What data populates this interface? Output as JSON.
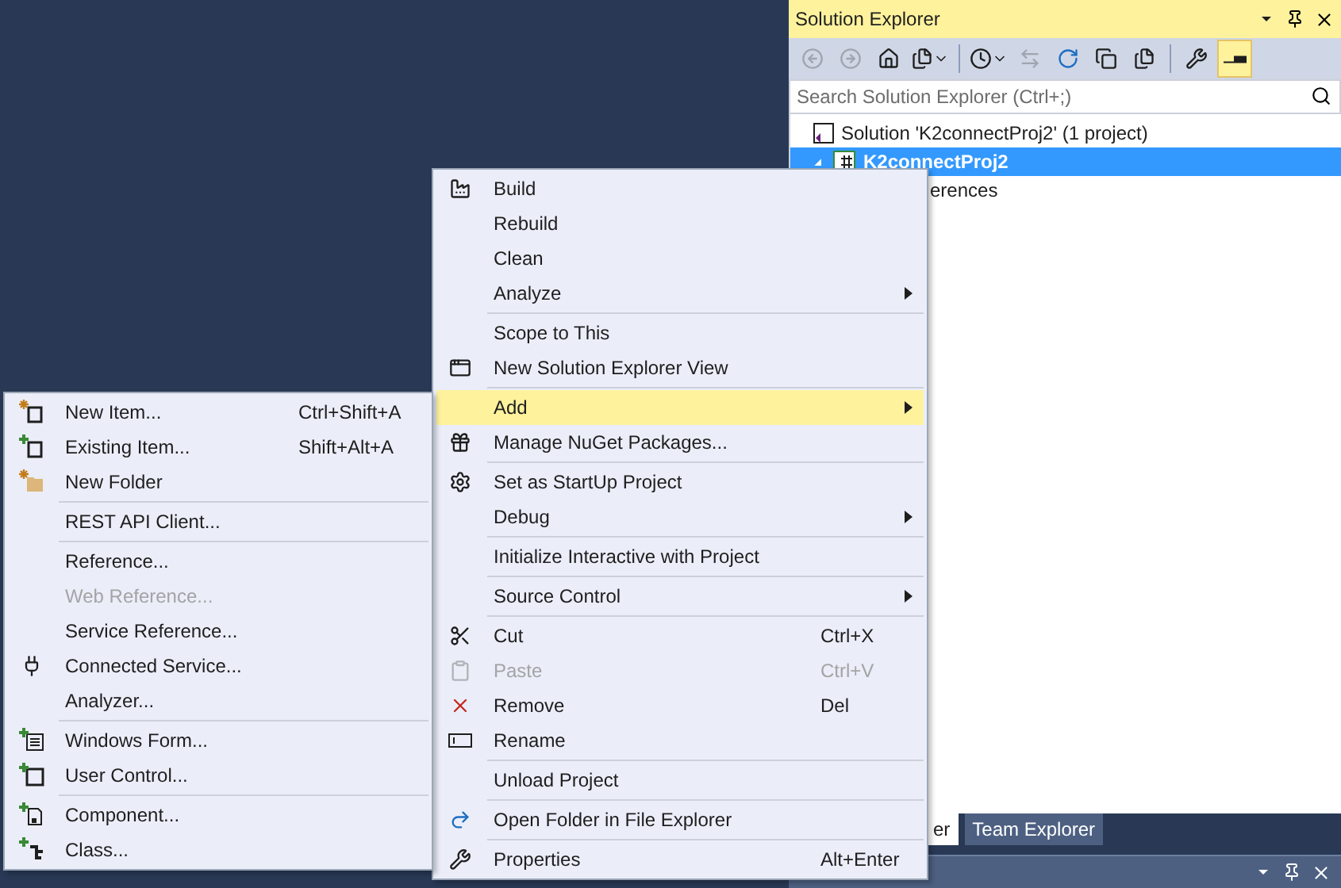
{
  "solution_explorer": {
    "title": "Solution Explorer",
    "toolbar_buttons": [
      {
        "disabled": true,
        "pressed": false
      },
      {
        "disabled": true,
        "pressed": false
      },
      {
        "disabled": false,
        "pressed": false
      },
      {
        "disabled": false,
        "pressed": false
      },
      {
        "disabled": false,
        "pressed": false
      },
      {
        "disabled": true,
        "pressed": false
      },
      {
        "disabled": false,
        "pressed": false
      },
      {
        "disabled": false,
        "pressed": false
      },
      {
        "disabled": false,
        "pressed": false
      },
      {
        "disabled": false,
        "pressed": false
      },
      {
        "disabled": false,
        "pressed": true
      }
    ],
    "search": {
      "placeholder": "Search Solution Explorer (Ctrl+;)"
    },
    "tree": [
      {
        "label": "Solution 'K2connectProj2' (1 project)",
        "selected": false,
        "children": [
          {
            "label": "K2connectProj2",
            "selected": true,
            "children": [
              {
                "label": "erences",
                "selected": false
              }
            ]
          }
        ]
      }
    ],
    "tabs": [
      {
        "label": "er",
        "selected": true
      },
      {
        "label": "Team Explorer",
        "selected": false
      }
    ]
  },
  "context_menu": {
    "items": [
      {
        "kind": "item",
        "label": "Build",
        "submenu": false,
        "disabled": false,
        "selected": false
      },
      {
        "kind": "item",
        "label": "Rebuild",
        "submenu": false,
        "disabled": false,
        "selected": false
      },
      {
        "kind": "item",
        "label": "Clean",
        "submenu": false,
        "disabled": false,
        "selected": false
      },
      {
        "kind": "item",
        "label": "Analyze",
        "submenu": true,
        "disabled": false,
        "selected": false
      },
      {
        "kind": "separator"
      },
      {
        "kind": "item",
        "label": "Scope to This",
        "submenu": false,
        "disabled": false,
        "selected": false
      },
      {
        "kind": "item",
        "label": "New Solution Explorer View",
        "submenu": false,
        "disabled": false,
        "selected": false
      },
      {
        "kind": "separator"
      },
      {
        "kind": "item",
        "label": "Add",
        "submenu": true,
        "disabled": false,
        "selected": true
      },
      {
        "kind": "item",
        "label": "Manage NuGet Packages...",
        "submenu": false,
        "disabled": false,
        "selected": false
      },
      {
        "kind": "separator"
      },
      {
        "kind": "item",
        "label": "Set as StartUp Project",
        "submenu": false,
        "disabled": false,
        "selected": false
      },
      {
        "kind": "item",
        "label": "Debug",
        "submenu": true,
        "disabled": false,
        "selected": false
      },
      {
        "kind": "separator"
      },
      {
        "kind": "item",
        "label": "Initialize Interactive with Project",
        "submenu": false,
        "disabled": false,
        "selected": false
      },
      {
        "kind": "separator"
      },
      {
        "kind": "item",
        "label": "Source Control",
        "submenu": true,
        "disabled": false,
        "selected": false
      },
      {
        "kind": "separator"
      },
      {
        "kind": "item",
        "label": "Cut",
        "shortcut": "Ctrl+X",
        "submenu": false,
        "disabled": false,
        "selected": false
      },
      {
        "kind": "item",
        "label": "Paste",
        "shortcut": "Ctrl+V",
        "submenu": false,
        "disabled": true,
        "selected": false
      },
      {
        "kind": "item",
        "label": "Remove",
        "shortcut": "Del",
        "submenu": false,
        "disabled": false,
        "selected": false
      },
      {
        "kind": "item",
        "label": "Rename",
        "submenu": false,
        "disabled": false,
        "selected": false
      },
      {
        "kind": "separator"
      },
      {
        "kind": "item",
        "label": "Unload Project",
        "submenu": false,
        "disabled": false,
        "selected": false
      },
      {
        "kind": "separator"
      },
      {
        "kind": "item",
        "label": "Open Folder in File Explorer",
        "submenu": false,
        "disabled": false,
        "selected": false
      },
      {
        "kind": "separator"
      },
      {
        "kind": "item",
        "label": "Properties",
        "shortcut": "Alt+Enter",
        "submenu": false,
        "disabled": false,
        "selected": false
      }
    ]
  },
  "add_submenu": {
    "items": [
      {
        "kind": "item",
        "label": "New Item...",
        "shortcut": "Ctrl+Shift+A",
        "disabled": false,
        "selected": false
      },
      {
        "kind": "item",
        "label": "Existing Item...",
        "shortcut": "Shift+Alt+A",
        "disabled": false,
        "selected": false
      },
      {
        "kind": "item",
        "label": "New Folder",
        "disabled": false,
        "selected": false
      },
      {
        "kind": "separator"
      },
      {
        "kind": "item",
        "label": "REST API Client...",
        "disabled": false,
        "selected": false
      },
      {
        "kind": "separator"
      },
      {
        "kind": "item",
        "label": "Reference...",
        "disabled": false,
        "selected": false
      },
      {
        "kind": "item",
        "label": "Web Reference...",
        "disabled": true,
        "selected": false
      },
      {
        "kind": "item",
        "label": "Service Reference...",
        "disabled": false,
        "selected": false
      },
      {
        "kind": "item",
        "label": "Connected Service...",
        "disabled": false,
        "selected": false
      },
      {
        "kind": "item",
        "label": "Analyzer...",
        "disabled": false,
        "selected": false
      },
      {
        "kind": "separator"
      },
      {
        "kind": "item",
        "label": "Windows Form...",
        "disabled": false,
        "selected": false
      },
      {
        "kind": "item",
        "label": "User Control...",
        "disabled": false,
        "selected": false
      },
      {
        "kind": "separator"
      },
      {
        "kind": "item",
        "label": "Component...",
        "disabled": false,
        "selected": false
      },
      {
        "kind": "item",
        "label": "Class...",
        "disabled": false,
        "selected": false
      }
    ]
  }
}
